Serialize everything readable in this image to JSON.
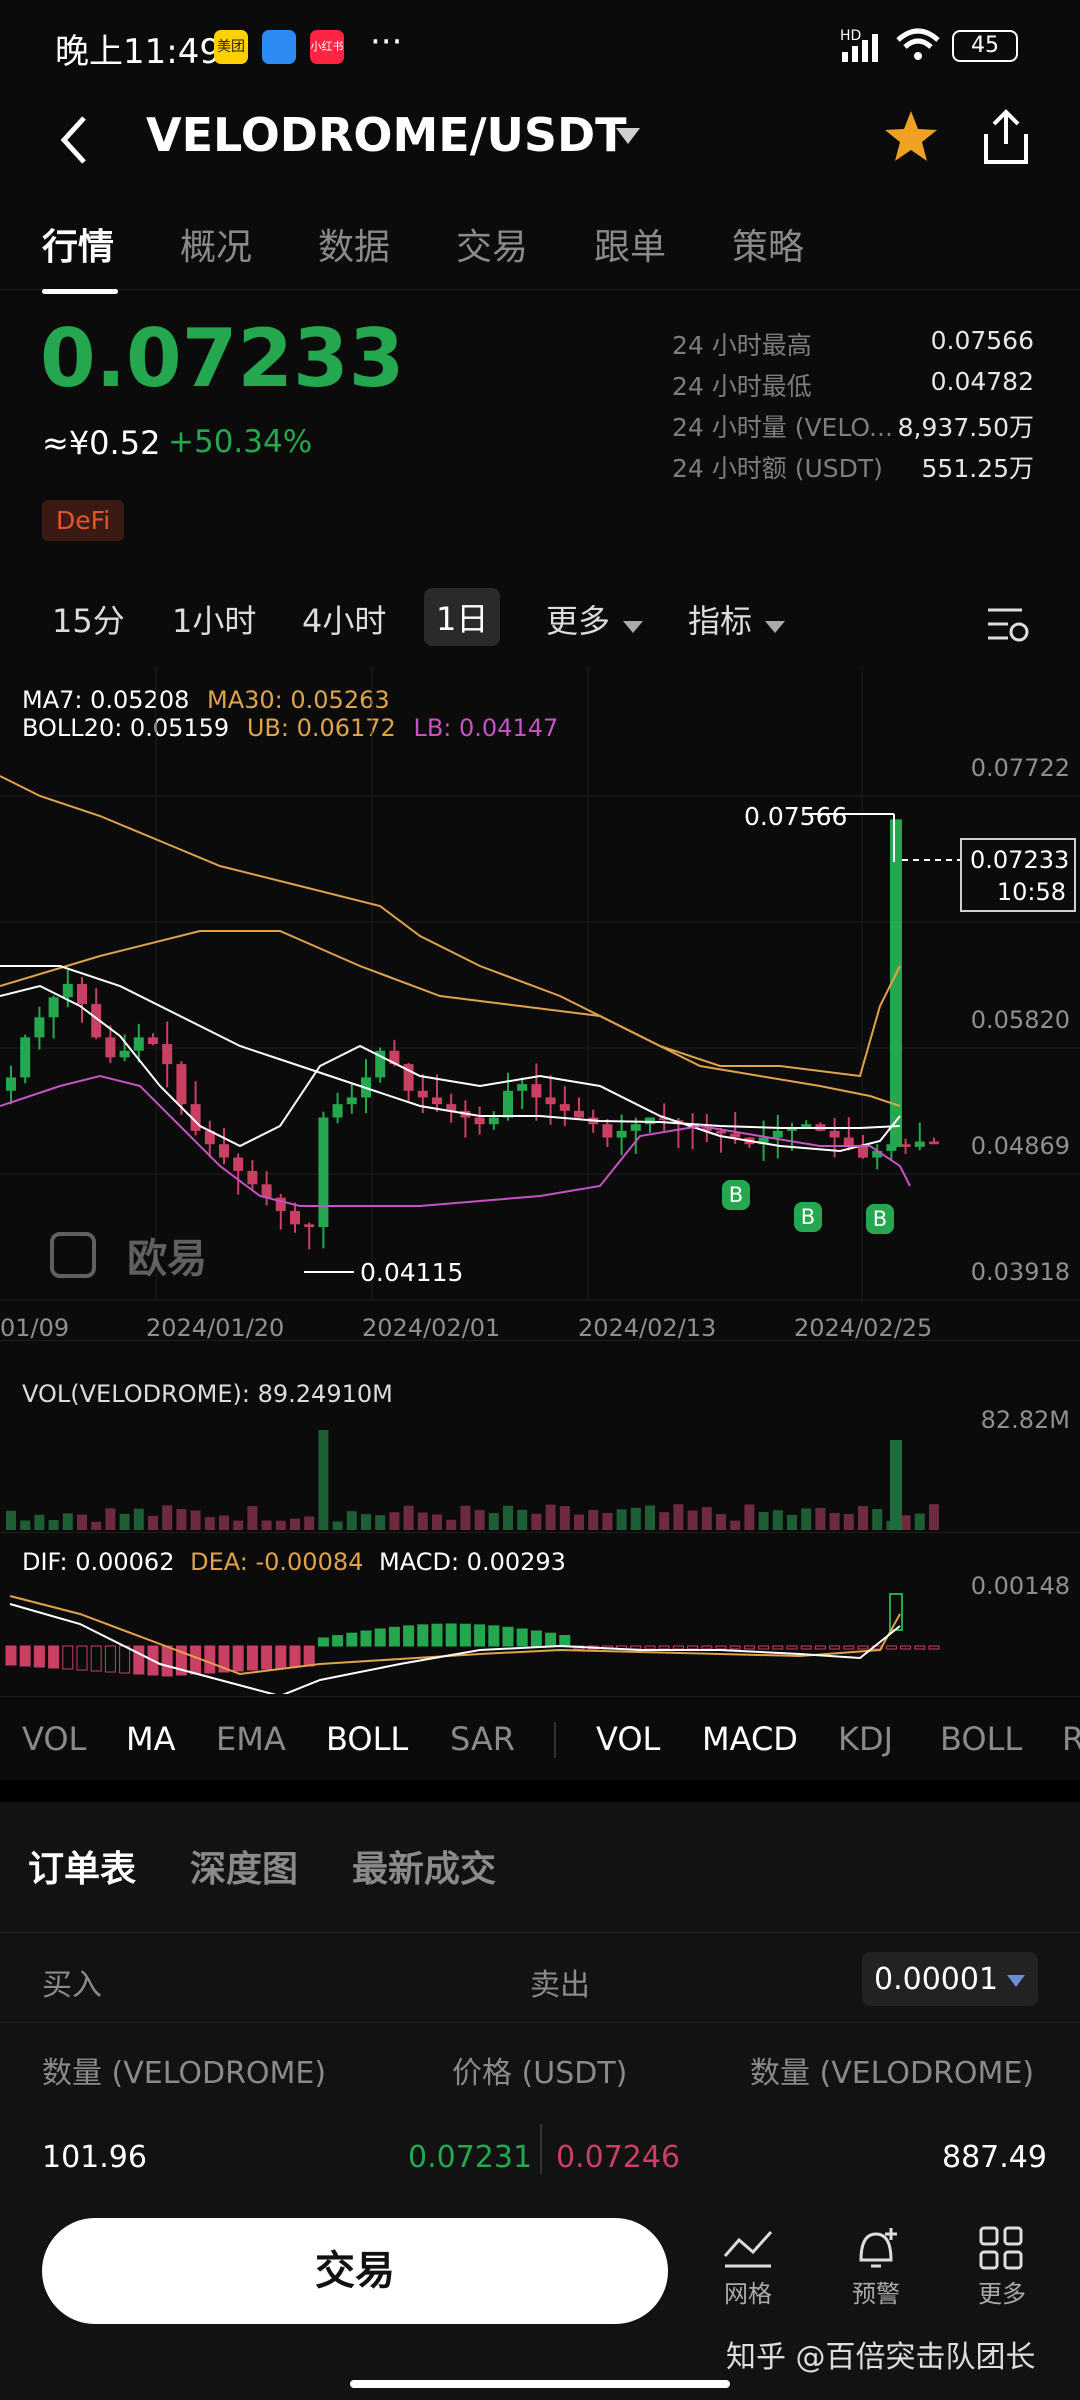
{
  "status": {
    "time": "晚上11:49",
    "apps": [
      "美团",
      "",
      "小红书"
    ],
    "more": "···",
    "battery": "45",
    "signal": "HD"
  },
  "header": {
    "pair": "VELODROME/USDT",
    "starred": true
  },
  "tabs": [
    "行情",
    "概况",
    "数据",
    "交易",
    "跟单",
    "策略"
  ],
  "price": {
    "last": "0.07233",
    "cny": "≈¥0.52",
    "change": "+50.34%",
    "tag": "DeFi"
  },
  "stats": [
    {
      "label": "24 小时最高",
      "value": "0.07566"
    },
    {
      "label": "24 小时最低",
      "value": "0.04782"
    },
    {
      "label": "24 小时量 (VELO...",
      "value": "8,937.50万"
    },
    {
      "label": "24 小时额 (USDT)",
      "value": "551.25万"
    }
  ],
  "periods": [
    "15分",
    "1小时",
    "4小时",
    "1日",
    "更多",
    "指标"
  ],
  "chart_legend": {
    "ma7": "MA7: 0.05208",
    "ma30": "MA30: 0.05263",
    "boll": "BOLL20: 0.05159",
    "ub": "UB: 0.06172",
    "lb": "LB: 0.04147"
  },
  "price_axis": [
    "0.07722",
    "0.05820",
    "0.04869",
    "0.03918"
  ],
  "price_flags": {
    "high": "0.07566",
    "low": "0.04115",
    "current": "0.07233",
    "countdown": "10:58"
  },
  "watermark": "欧易",
  "date_axis": [
    "01/09",
    "2024/01/20",
    "2024/02/01",
    "2024/02/13",
    "2024/02/25"
  ],
  "vol": {
    "legend": "VOL(VELODROME): 89.24910M",
    "axis": "82.82M"
  },
  "macd": {
    "dif": "DIF: 0.00062",
    "dea": "DEA: -0.00084",
    "macd": "MACD: 0.00293",
    "axis": "0.00148"
  },
  "indicator_tabs_main": [
    "VOL",
    "MA",
    "EMA",
    "BOLL",
    "SAR"
  ],
  "indicator_tabs_sub": [
    "VOL",
    "MACD",
    "KDJ",
    "BOLL",
    "R"
  ],
  "orderbook": {
    "tabs": [
      "订单表",
      "深度图",
      "最新成交"
    ],
    "buy": "买入",
    "sell": "卖出",
    "precision": "0.00001",
    "col_qty_left": "数量 (VELODROME)",
    "col_price": "价格 (USDT)",
    "col_qty_right": "数量 (VELODROME)",
    "row": {
      "bid_qty": "101.96",
      "bid_price": "0.07231",
      "ask_price": "0.07246",
      "ask_qty": "887.49"
    }
  },
  "bottom": {
    "trade": "交易",
    "grid": "网格",
    "alert": "预警",
    "more": "更多",
    "credit": "知乎 @百倍突击队团长"
  },
  "colors": {
    "up": "#25a750",
    "down": "#ca3f64",
    "accent": "#f0a023",
    "ma30": "#e0a34a",
    "lb": "#c653c6"
  }
}
